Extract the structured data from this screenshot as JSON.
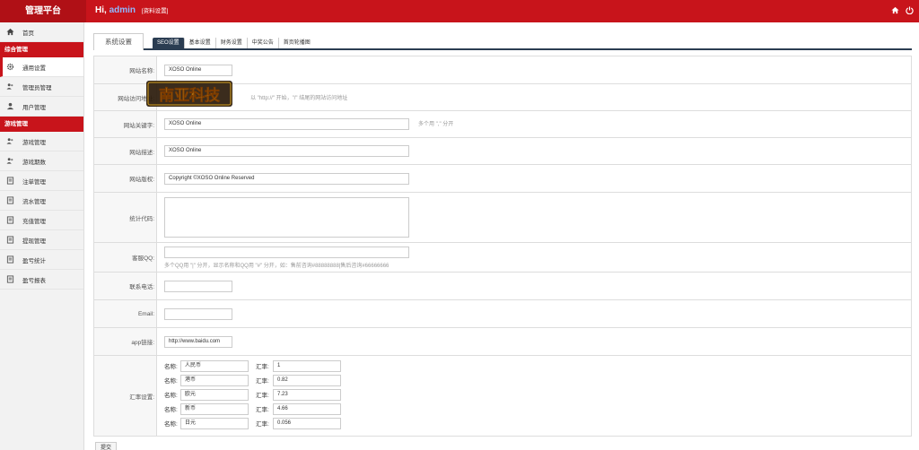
{
  "header": {
    "brand": "管理平台",
    "greeting": "Hi,",
    "username": "admin",
    "profile_link": "[资料设置]"
  },
  "sidebar": {
    "home": "首页",
    "section1": "综合管理",
    "section1_items": [
      "通用设置",
      "管理员管理",
      "用户管理"
    ],
    "section2": "游戏管理",
    "section2_items": [
      "游戏管理",
      "游戏期数",
      "注单管理",
      "流水管理",
      "充值管理",
      "提现管理",
      "盈亏统计",
      "盈亏报表"
    ]
  },
  "tabs": {
    "main": "系统设置",
    "sub": [
      "SEO设置",
      "基本设置",
      "财务设置",
      "中奖公告",
      "首页轮播图"
    ]
  },
  "form": {
    "site_name_label": "网站名称:",
    "site_name_value": "XOSO Online",
    "site_url_label": "网站访问地址:",
    "site_url_hint": "以 \"http://\" 开始，\"/\" 结尾的网站访问地址",
    "keywords_label": "网站关键字:",
    "keywords_value": "XOSO Online",
    "keywords_hint": "多个用 \",\" 分开",
    "description_label": "网站描述:",
    "description_value": "XOSO Online",
    "copyright_label": "网站版权:",
    "copyright_value": "Copyright ©XOSO Online Reserved",
    "stats_label": "统计代码:",
    "qq_label": "客服QQ:",
    "qq_hint": "多个QQ用 \"|\" 分开，显示名称和QQ用 \"#\" 分开，如：售前咨询#88888888|售后咨询#66666666",
    "phone_label": "联系电话:",
    "email_label": "Email:",
    "app_label": "app链接:",
    "app_value": "http://www.baidu.com",
    "rate_label": "汇率设置:",
    "name_label": "名称:",
    "rate_item_label": "汇率:",
    "rates": [
      {
        "name": "人民币",
        "rate": "1"
      },
      {
        "name": "港币",
        "rate": "0.82"
      },
      {
        "name": "欧元",
        "rate": "7.23"
      },
      {
        "name": "新币",
        "rate": "4.66"
      },
      {
        "name": "日元",
        "rate": "0.056"
      }
    ],
    "submit": "提交"
  },
  "watermark": "南亚科技"
}
